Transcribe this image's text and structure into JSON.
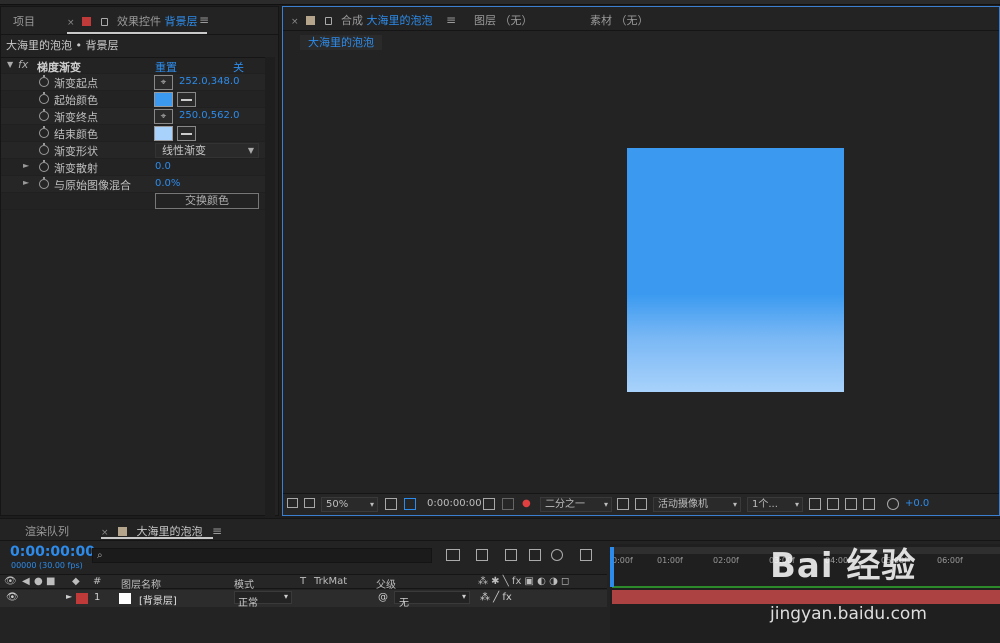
{
  "effects_panel": {
    "tab_project": "项目",
    "tab_effects_prefix": "效果控件",
    "tab_effects_layer": "背景层",
    "title": "大海里的泡泡 • 背景层",
    "effect_name": "梯度渐变",
    "reset_label": "重置",
    "about_label": "关于...",
    "properties": [
      {
        "name": "渐变起点",
        "value": "252.0,348.0"
      },
      {
        "name": "起始颜色",
        "swatch": "#3b9af0"
      },
      {
        "name": "渐变终点",
        "value": "250.0,562.0"
      },
      {
        "name": "结束颜色",
        "swatch": "#a8d2fb"
      },
      {
        "name": "渐变形状",
        "dropdown": "线性渐变"
      },
      {
        "name": "渐变散射",
        "value": "0.0"
      },
      {
        "name": "与原始图像混合",
        "value": "0.0%"
      }
    ],
    "swap_colors_button": "交换颜色"
  },
  "comp_panel": {
    "comp_prefix": "合成",
    "comp_name": "大海里的泡泡",
    "tab_layer": "图层 （无）",
    "tab_footage": "素材 （无）",
    "breadcrumb": "大海里的泡泡",
    "bottom": {
      "zoom": "50%",
      "timecode": "0:00:00:00",
      "resolution": "二分之一",
      "camera": "活动摄像机",
      "views": "1个...",
      "exposure": "+0.0"
    }
  },
  "timeline": {
    "tab_render_queue": "渲染队列",
    "tab_comp": "大海里的泡泡",
    "timecode": "0:00:00:00",
    "fps": "00000 (30.00 fps)",
    "search_icon_glyph": "⌕",
    "columns": {
      "hash": "#",
      "layer_name": "图层名称",
      "mode": "模式",
      "t": "T",
      "trkmat": "TrkMat",
      "parent": "父级"
    },
    "layers": [
      {
        "index": "1",
        "name": "[背景层]",
        "mode": "正常",
        "parent": "无"
      }
    ],
    "ruler_ticks": [
      "0:00f",
      "01:00f",
      "02:00f",
      "03:00f",
      "04:00f",
      "05:00f",
      "06:00f"
    ]
  },
  "watermark": {
    "logo": "Bai 经验",
    "url": "jingyan.baidu.com"
  },
  "colors": {
    "accent": "#2d8ceb",
    "gradient_start": "#3b9af0",
    "gradient_end": "#a8d2fb",
    "layer_label": "#c03a3a",
    "track": "#ad4242"
  }
}
